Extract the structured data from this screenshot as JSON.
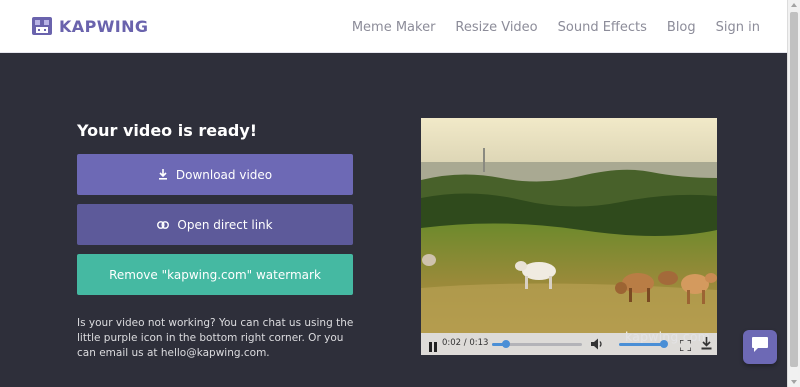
{
  "header": {
    "logo_text": "KAPWING",
    "nav": [
      {
        "label": "Meme Maker"
      },
      {
        "label": "Resize Video"
      },
      {
        "label": "Sound Effects"
      },
      {
        "label": "Blog"
      },
      {
        "label": "Sign in"
      }
    ]
  },
  "main": {
    "title": "Your video is ready!",
    "buttons": {
      "download": "Download video",
      "open_link": "Open direct link",
      "remove_watermark": "Remove \"kapwing.com\" watermark"
    },
    "help_text": "Is your video not working? You can chat us using the little purple icon in the bottom right corner. Or you can email us at hello@kapwing.com."
  },
  "video": {
    "time": "0:02 / 0:13",
    "progress_fraction": 0.15,
    "volume_fraction": 1.0,
    "watermark": "kapwing.com",
    "state": "playing"
  },
  "colors": {
    "background": "#2e2f3a",
    "brand": "#6a63ad",
    "download_button": "#6d69b5",
    "link_button": "#5d5a9a",
    "watermark_button": "#45b9a2",
    "player_accent": "#4a8fd6"
  },
  "icons": {
    "download": "download-icon",
    "link": "link-icon",
    "pause": "pause-icon",
    "volume": "volume-icon",
    "fullscreen": "fullscreen-icon",
    "chat": "chat-bubble-icon"
  }
}
